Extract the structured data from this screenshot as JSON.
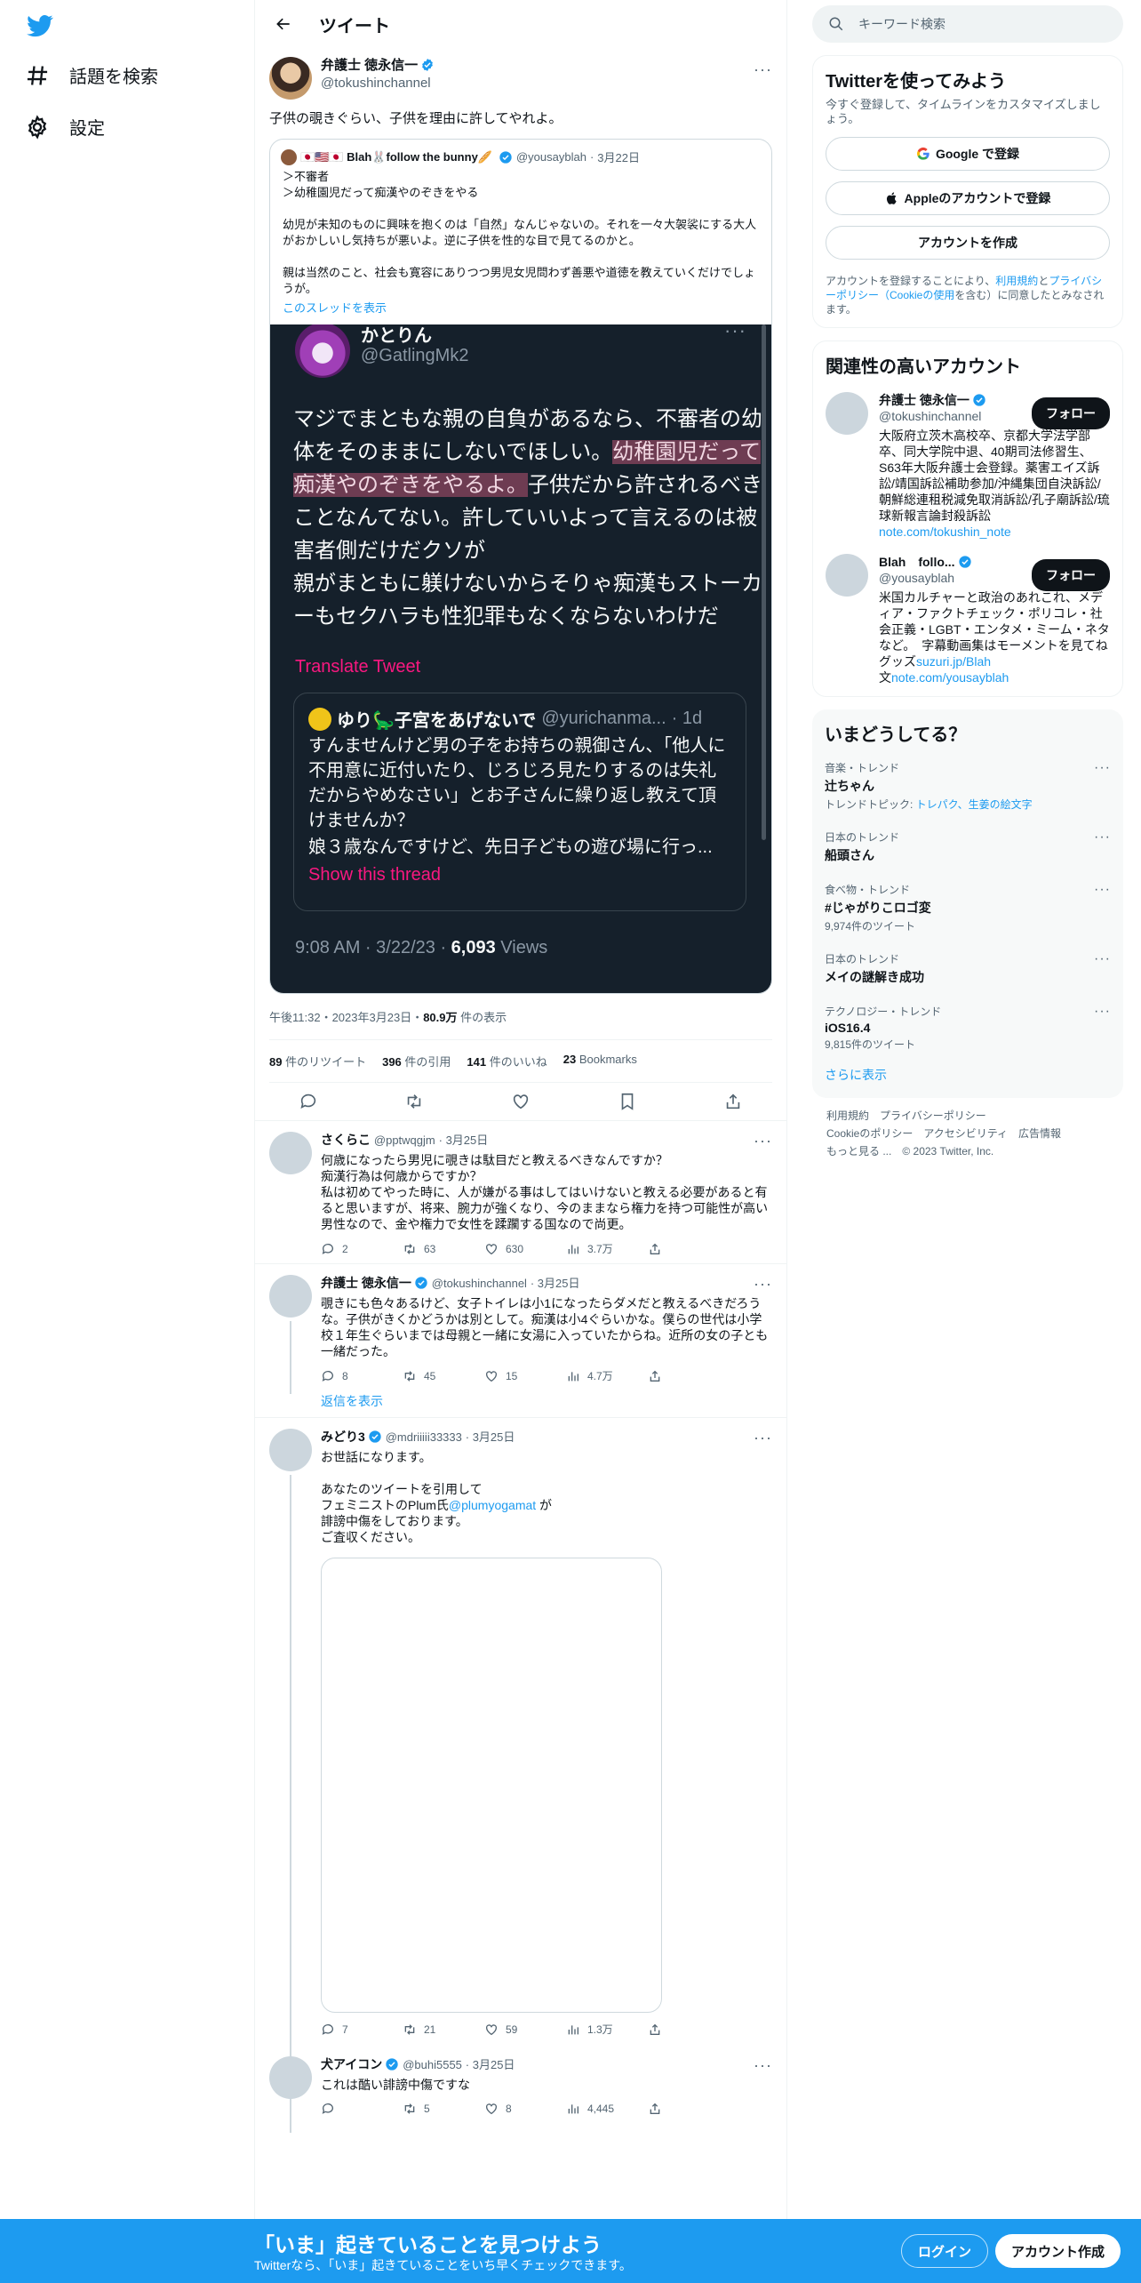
{
  "nav": {
    "explore": "話題を検索",
    "settings": "設定"
  },
  "header": {
    "title": "ツイート"
  },
  "tweet": {
    "display_name": "弁護士 徳永信一",
    "handle": "@tokushinchannel",
    "text": "子供の覗きぐらい、子供を理由に許してやれよ。",
    "quote": {
      "display_name": "🇯🇵🇺🇸🇯🇵 Blah🐰follow the bunny🥖",
      "handle": "@yousayblah",
      "date": "3月22日",
      "line1": "＞不審者",
      "line2": "＞幼稚園児だって痴漢やのぞきをやる",
      "para2": "幼児が未知のものに興味を抱くのは「自然」なんじゃないの。それを一々大袈裟にする大人がおかしいし気持ちが悪いよ。逆に子供を性的な目で見てるのかと。",
      "para3": "親は当然のこと、社会も寛容にありつつ男児女児問わず善悪や道徳を教えていくだけでしょうが。",
      "show_thread": "このスレッドを表示"
    },
    "screenshot": {
      "name": "かとりん",
      "handle": "@GatlingMk2",
      "text_a": "マジでまともな親の自負があるなら、不審者の幼体をそのままにしないでほしい。",
      "text_hl": "幼稚園児だって痴漢やのぞきをやるよ。",
      "text_b": "子供だから許されるべきことなんてない。許していいよって言えるのは被害者側だけだクソが",
      "text_c": "親がまともに躾けないからそりゃ痴漢もストーカーもセクハラも性犯罪もなくならないわけだ",
      "translate": "Translate Tweet",
      "q_name": "ゆり🦕子宮をあげないで",
      "q_handle": "@yurichanma...",
      "q_age": "· 1d",
      "q_text1": "すんませんけど男の子をお持ちの親御さん、「他人に不用意に近付いたり、じろじろ見たりするのは失礼だからやめなさい」とお子さんに繰り返し教えて頂けませんか？",
      "q_text2": "娘３歳なんですけど、先日子どもの遊び場に行っ...",
      "q_show": "Show this thread",
      "time": "9:08 AM · 3/22/23 · ",
      "views_num": "6,093",
      "views_label": " Views"
    },
    "timestamp": "午後11:32・2023年3月23日・",
    "views_num": "80.9万",
    "views_label": " 件の表示",
    "retweets_num": "89",
    "retweets_label": " 件のリツイート",
    "quotes_num": "396",
    "quotes_label": " 件の引用",
    "likes_num": "141",
    "likes_label": " 件のいいね",
    "bookmarks_num": "23",
    "bookmarks_label": " Bookmarks"
  },
  "replies": [
    {
      "display_name": "さくらこ",
      "handle": "@pptwqgjm",
      "date": "· 3月25日",
      "text": "何歳になったら男児に覗きは駄目だと教えるべきなんですか？\n痴漢行為は何歳からですか？\n私は初めてやった時に、人が嫌がる事はしてはいけないと教える必要があると有ると思いますが、将来、腕力が強くなり、今のままなら権力を持つ可能性が高い男性なので、金や権力で女性を蹂躙する国なので尚更。",
      "replies": "2",
      "retweets": "63",
      "likes": "630",
      "views": "3.7万"
    },
    {
      "display_name": "弁護士 徳永信一",
      "handle": "@tokushinchannel",
      "date": "· 3月25日",
      "text": "覗きにも色々あるけど、女子トイレは小1になったらダメだと教えるべきだろうな。子供がきくかどうかは別として。痴漢は小4ぐらいかな。僕らの世代は小学校１年生ぐらいまでは母親と一緒に女湯に入っていたからね。近所の女の子とも一緒だった。",
      "replies": "8",
      "retweets": "45",
      "likes": "15",
      "views": "4.7万",
      "show_replies": "返信を表示"
    },
    {
      "display_name": "みどり3",
      "handle": "@mdriiiii33333",
      "date": "· 3月25日",
      "text1": "お世話になります。",
      "text2": "あなたのツイートを引用して",
      "text3a": "フェミニストのPlum氏",
      "mention": "@plumyogamat",
      "text3b": " が",
      "text4": "誹謗中傷をしております。",
      "text5": "ご査収ください。",
      "replies": "7",
      "retweets": "21",
      "likes": "59",
      "views": "1.3万"
    },
    {
      "display_name": "犬アイコン",
      "handle": "@buhi5555",
      "date": "· 3月25日",
      "text": "これは酷い誹謗中傷ですな",
      "replies": "",
      "retweets": "5",
      "likes": "8",
      "views": "4,445"
    }
  ],
  "sidebar": {
    "search_placeholder": "キーワード検索",
    "signup": {
      "title": "Twitterを使ってみよう",
      "sub": "今すぐ登録して、タイムラインをカスタマイズしましょう。",
      "google": "Google で登録",
      "apple": "Appleのアカウントで登録",
      "create": "アカウントを作成",
      "terms_a": "アカウントを登録することにより、",
      "terms_link1": "利用規約",
      "terms_b": "と",
      "terms_link2": "プライバシーポリシー（Cookieの使用",
      "terms_c": "を含む）に同意したとみなされます。"
    },
    "related": {
      "title": "関連性の高いアカウント",
      "follow": "フォロー",
      "accounts": [
        {
          "name": "弁護士 徳永信一",
          "handle": "@tokushinchannel",
          "bio": "大阪府立茨木高校卒、京都大学法学部卒、同大学院中退、40期司法修習生、S63年大阪弁護士会登録。薬害エイズ訴訟/靖国訴訟補助参加/沖縄集団自決訴訟/朝鮮総連租税減免取消訴訟/孔子廟訴訟/琉球新報言論封殺訴訟",
          "link": "note.com/tokushin_note"
        },
        {
          "name": "Blah　follo...",
          "handle": "@yousayblah",
          "bio": "米国カルチャーと政治のあれこれ、メディア・ファクトチェック・ポリコレ・社会正義・LGBT・エンタメ・ミーム・ネタなど。　字幕動画集はモーメントを見てね　　グッズ",
          "link1": "suzuri.jp/Blah",
          "bio2": "文",
          "link2": "note.com/yousayblah"
        }
      ]
    },
    "trends": {
      "title": "いまどうしてる？",
      "items": [
        {
          "cat": "音楽・トレンド",
          "name": "辻ちゃん",
          "extra_a": "トレンドトピック: ",
          "extra_b": "トレパク、生姜の絵文字"
        },
        {
          "cat": "日本のトレンド",
          "name": "船頭さん",
          "extra_a": "",
          "extra_b": ""
        },
        {
          "cat": "食べ物・トレンド",
          "name": "#じゃがりこロゴ変",
          "extra_a": "9,974件のツイート",
          "extra_b": ""
        },
        {
          "cat": "日本のトレンド",
          "name": "メイの謎解き成功",
          "extra_a": "",
          "extra_b": ""
        },
        {
          "cat": "テクノロジー・トレンド",
          "name": "iOS16.4",
          "extra_a": "9,815件のツイート",
          "extra_b": ""
        }
      ],
      "show_more": "さらに表示"
    },
    "footer": {
      "terms": "利用規約",
      "privacy": "プライバシーポリシー",
      "cookie": "Cookieのポリシー",
      "access": "アクセシビリティ",
      "ads": "広告情報",
      "more": "もっと見る ...",
      "copyright": "© 2023 Twitter, Inc."
    }
  },
  "bottom": {
    "title": "「いま」起きていることを見つけよう",
    "sub": "Twitterなら、「いま」起きていることをいち早くチェックできます。",
    "login": "ログイン",
    "signup": "アカウント作成"
  },
  "colors": {
    "accent": "#1d9bf0",
    "text": "#0f1419",
    "muted": "#536471",
    "dark_bg": "#15202b",
    "highlight": "#6e3c52",
    "pink": "#f91880"
  }
}
